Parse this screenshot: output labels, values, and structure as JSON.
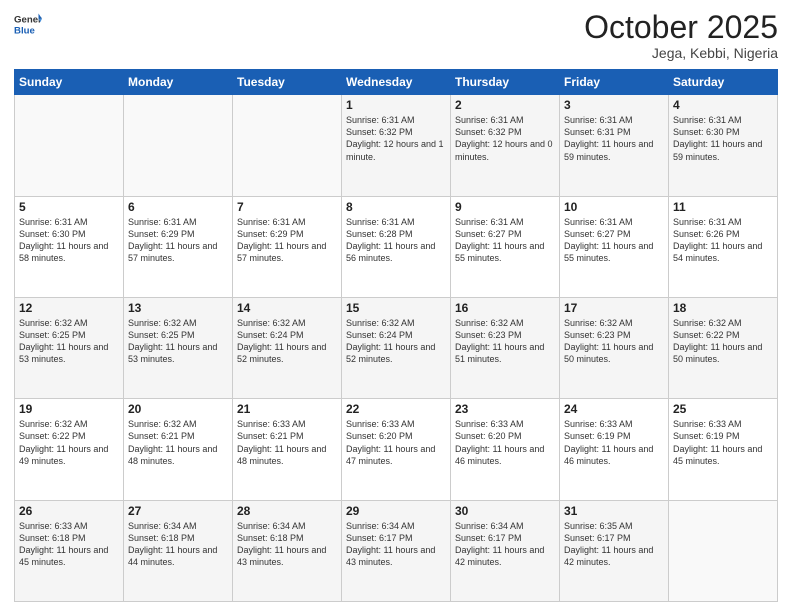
{
  "header": {
    "logo_general": "General",
    "logo_blue": "Blue",
    "title": "October 2025",
    "location": "Jega, Kebbi, Nigeria"
  },
  "days_of_week": [
    "Sunday",
    "Monday",
    "Tuesday",
    "Wednesday",
    "Thursday",
    "Friday",
    "Saturday"
  ],
  "weeks": [
    [
      {
        "day": "",
        "info": ""
      },
      {
        "day": "",
        "info": ""
      },
      {
        "day": "",
        "info": ""
      },
      {
        "day": "1",
        "info": "Sunrise: 6:31 AM\nSunset: 6:32 PM\nDaylight: 12 hours and 1 minute."
      },
      {
        "day": "2",
        "info": "Sunrise: 6:31 AM\nSunset: 6:32 PM\nDaylight: 12 hours and 0 minutes."
      },
      {
        "day": "3",
        "info": "Sunrise: 6:31 AM\nSunset: 6:31 PM\nDaylight: 11 hours and 59 minutes."
      },
      {
        "day": "4",
        "info": "Sunrise: 6:31 AM\nSunset: 6:30 PM\nDaylight: 11 hours and 59 minutes."
      }
    ],
    [
      {
        "day": "5",
        "info": "Sunrise: 6:31 AM\nSunset: 6:30 PM\nDaylight: 11 hours and 58 minutes."
      },
      {
        "day": "6",
        "info": "Sunrise: 6:31 AM\nSunset: 6:29 PM\nDaylight: 11 hours and 57 minutes."
      },
      {
        "day": "7",
        "info": "Sunrise: 6:31 AM\nSunset: 6:29 PM\nDaylight: 11 hours and 57 minutes."
      },
      {
        "day": "8",
        "info": "Sunrise: 6:31 AM\nSunset: 6:28 PM\nDaylight: 11 hours and 56 minutes."
      },
      {
        "day": "9",
        "info": "Sunrise: 6:31 AM\nSunset: 6:27 PM\nDaylight: 11 hours and 55 minutes."
      },
      {
        "day": "10",
        "info": "Sunrise: 6:31 AM\nSunset: 6:27 PM\nDaylight: 11 hours and 55 minutes."
      },
      {
        "day": "11",
        "info": "Sunrise: 6:31 AM\nSunset: 6:26 PM\nDaylight: 11 hours and 54 minutes."
      }
    ],
    [
      {
        "day": "12",
        "info": "Sunrise: 6:32 AM\nSunset: 6:25 PM\nDaylight: 11 hours and 53 minutes."
      },
      {
        "day": "13",
        "info": "Sunrise: 6:32 AM\nSunset: 6:25 PM\nDaylight: 11 hours and 53 minutes."
      },
      {
        "day": "14",
        "info": "Sunrise: 6:32 AM\nSunset: 6:24 PM\nDaylight: 11 hours and 52 minutes."
      },
      {
        "day": "15",
        "info": "Sunrise: 6:32 AM\nSunset: 6:24 PM\nDaylight: 11 hours and 52 minutes."
      },
      {
        "day": "16",
        "info": "Sunrise: 6:32 AM\nSunset: 6:23 PM\nDaylight: 11 hours and 51 minutes."
      },
      {
        "day": "17",
        "info": "Sunrise: 6:32 AM\nSunset: 6:23 PM\nDaylight: 11 hours and 50 minutes."
      },
      {
        "day": "18",
        "info": "Sunrise: 6:32 AM\nSunset: 6:22 PM\nDaylight: 11 hours and 50 minutes."
      }
    ],
    [
      {
        "day": "19",
        "info": "Sunrise: 6:32 AM\nSunset: 6:22 PM\nDaylight: 11 hours and 49 minutes."
      },
      {
        "day": "20",
        "info": "Sunrise: 6:32 AM\nSunset: 6:21 PM\nDaylight: 11 hours and 48 minutes."
      },
      {
        "day": "21",
        "info": "Sunrise: 6:33 AM\nSunset: 6:21 PM\nDaylight: 11 hours and 48 minutes."
      },
      {
        "day": "22",
        "info": "Sunrise: 6:33 AM\nSunset: 6:20 PM\nDaylight: 11 hours and 47 minutes."
      },
      {
        "day": "23",
        "info": "Sunrise: 6:33 AM\nSunset: 6:20 PM\nDaylight: 11 hours and 46 minutes."
      },
      {
        "day": "24",
        "info": "Sunrise: 6:33 AM\nSunset: 6:19 PM\nDaylight: 11 hours and 46 minutes."
      },
      {
        "day": "25",
        "info": "Sunrise: 6:33 AM\nSunset: 6:19 PM\nDaylight: 11 hours and 45 minutes."
      }
    ],
    [
      {
        "day": "26",
        "info": "Sunrise: 6:33 AM\nSunset: 6:18 PM\nDaylight: 11 hours and 45 minutes."
      },
      {
        "day": "27",
        "info": "Sunrise: 6:34 AM\nSunset: 6:18 PM\nDaylight: 11 hours and 44 minutes."
      },
      {
        "day": "28",
        "info": "Sunrise: 6:34 AM\nSunset: 6:18 PM\nDaylight: 11 hours and 43 minutes."
      },
      {
        "day": "29",
        "info": "Sunrise: 6:34 AM\nSunset: 6:17 PM\nDaylight: 11 hours and 43 minutes."
      },
      {
        "day": "30",
        "info": "Sunrise: 6:34 AM\nSunset: 6:17 PM\nDaylight: 11 hours and 42 minutes."
      },
      {
        "day": "31",
        "info": "Sunrise: 6:35 AM\nSunset: 6:17 PM\nDaylight: 11 hours and 42 minutes."
      },
      {
        "day": "",
        "info": ""
      }
    ]
  ]
}
